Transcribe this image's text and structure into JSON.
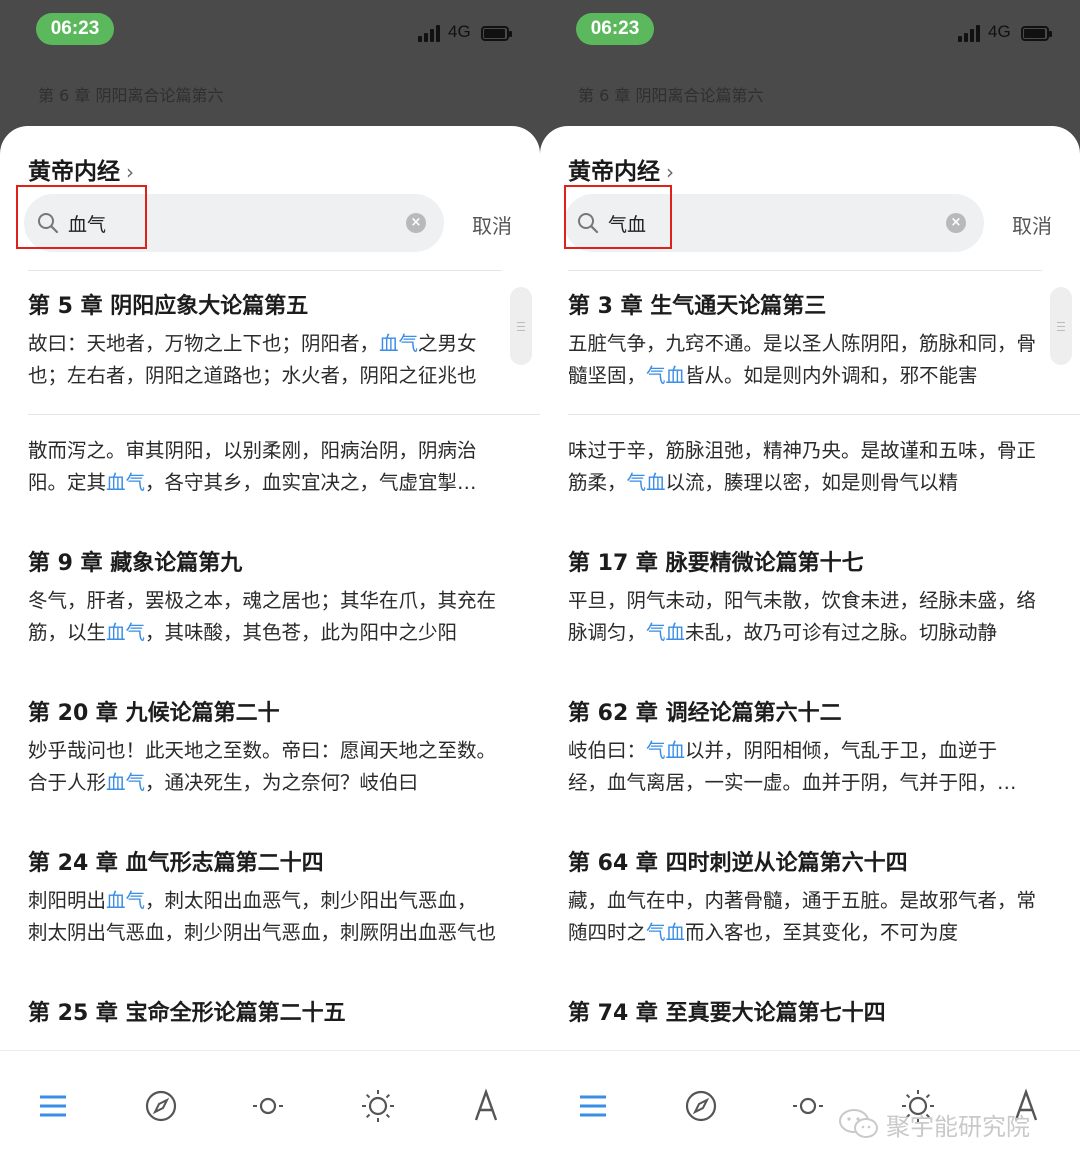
{
  "status_bar": {
    "time": "06:23",
    "network": "4G"
  },
  "colors": {
    "accent": "#3a8ee6",
    "time_pill": "#5cb85c",
    "highlight_box": "#e0201a"
  },
  "panels": [
    {
      "current_chapter": "第 6 章 阴阳离合论篇第六",
      "book_title": "黄帝内经",
      "search": {
        "query": "血气"
      },
      "cancel_label": "取消",
      "results": [
        {
          "chapter": "第 5 章 阴阳应象大论篇第五",
          "snippets": [
            {
              "pre": "故曰：天地者，万物之上下也；阴阳者，",
              "hit": "血气",
              "post": "之男女也；左右者，阴阳之道路也；水火者，阴阳之征兆也"
            },
            {
              "pre": "散而泻之。审其阴阳，以别柔刚，阳病治阴，阴病治阳。定其",
              "hit": "血气",
              "post": "，各守其乡，血实宜决之，气虚宜掣引之"
            }
          ]
        },
        {
          "chapter": "第 9 章 藏象论篇第九",
          "snippets": [
            {
              "pre": "冬气，肝者，罢极之本，魂之居也；其华在爪，其充在筋，以生",
              "hit": "血气",
              "post": "，其味酸，其色苍，此为阳中之少阳"
            }
          ]
        },
        {
          "chapter": "第 20 章 九候论篇第二十",
          "snippets": [
            {
              "pre": "妙乎哉问也！此天地之至数。帝曰：愿闻天地之至数。合于人形",
              "hit": "血气",
              "post": "，通决死生，为之奈何？岐伯曰"
            }
          ]
        },
        {
          "chapter": "第 24 章 血气形志篇第二十四",
          "snippets": [
            {
              "pre": "刺阳明出",
              "hit": "血气",
              "post": "，刺太阳出血恶气，刺少阳出气恶血，刺太阴出气恶血，刺少阴出气恶血，刺厥阴出血恶气也"
            }
          ]
        },
        {
          "chapter": "第 25 章 宝命全形论篇第二十五",
          "snippets": []
        }
      ],
      "toolbar": [
        "menu-icon",
        "compass-icon",
        "brightness-low-icon",
        "brightness-high-icon",
        "font-icon"
      ]
    },
    {
      "current_chapter": "第 6 章 阴阳离合论篇第六",
      "book_title": "黄帝内经",
      "search": {
        "query": "气血"
      },
      "cancel_label": "取消",
      "results": [
        {
          "chapter": "第 3 章 生气通天论篇第三",
          "snippets": [
            {
              "pre": "五脏气争，九窍不通。是以圣人陈阴阳，筋脉和同，骨髓坚固，",
              "hit": "气血",
              "post": "皆从。如是则内外调和，邪不能害"
            },
            {
              "pre": "味过于辛，筋脉沮弛，精神乃央。是故谨和五味，骨正筋柔，",
              "hit": "气血",
              "post": "以流，腠理以密，如是则骨气以精"
            }
          ]
        },
        {
          "chapter": "第 17 章 脉要精微论篇第十七",
          "snippets": [
            {
              "pre": "平旦，阴气未动，阳气未散，饮食未进，经脉未盛，络脉调匀，",
              "hit": "气血",
              "post": "未乱，故乃可诊有过之脉。切脉动静"
            }
          ]
        },
        {
          "chapter": "第 62 章 调经论篇第六十二",
          "snippets": [
            {
              "pre": "岐伯曰：",
              "hit": "气血",
              "post": "以并，阴阳相倾，气乱于卫，血逆于经，血气离居，一实一虚。血并于阴，气并于阳，故为惊狂"
            }
          ]
        },
        {
          "chapter": "第 64 章 四时刺逆从论篇第六十四",
          "snippets": [
            {
              "pre": "藏，血气在中，内著骨髓，通于五脏。是故邪气者，常随四时之",
              "hit": "气血",
              "post": "而入客也，至其变化，不可为度"
            }
          ]
        },
        {
          "chapter": "第 74 章 至真要大论篇第七十四",
          "snippets": []
        }
      ],
      "toolbar": [
        "menu-icon",
        "compass-icon",
        "brightness-low-icon",
        "brightness-high-icon",
        "font-icon"
      ]
    }
  ],
  "watermark": {
    "text": "聚宇能研究院",
    "icon": "wechat-icon"
  }
}
